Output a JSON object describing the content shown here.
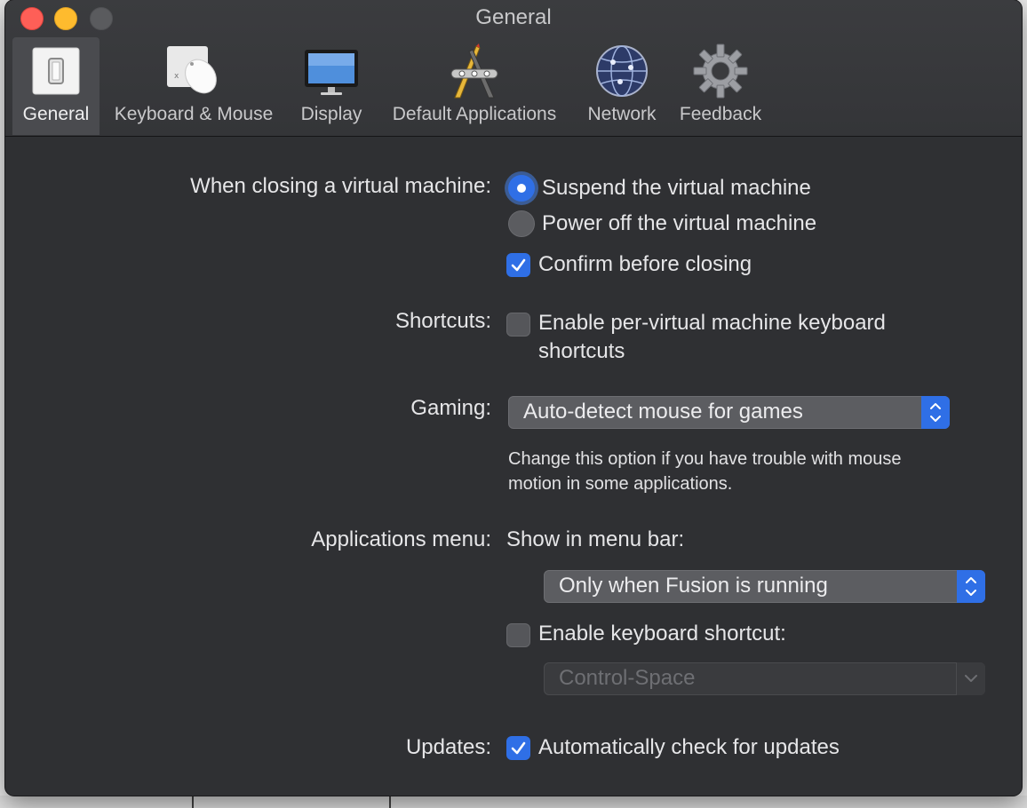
{
  "window": {
    "title": "General"
  },
  "toolbar": {
    "items": [
      {
        "label": "General",
        "icon": "switch-icon"
      },
      {
        "label": "Keyboard & Mouse",
        "icon": "mouse-icon"
      },
      {
        "label": "Display",
        "icon": "monitor-icon"
      },
      {
        "label": "Default Applications",
        "icon": "tools-icon"
      },
      {
        "label": "Network",
        "icon": "globe-icon"
      },
      {
        "label": "Feedback",
        "icon": "gear-icon"
      }
    ],
    "selected": "General"
  },
  "closing": {
    "label": "When closing a virtual machine:",
    "option_suspend": "Suspend the virtual machine",
    "option_poweroff": "Power off the virtual machine",
    "selected": "Suspend the virtual machine",
    "confirm_label": "Confirm before closing",
    "confirm_checked": true
  },
  "shortcuts": {
    "label": "Shortcuts:",
    "checkbox_line1": "Enable per-virtual machine keyboard",
    "checkbox_line2": "shortcuts",
    "checked": false
  },
  "gaming": {
    "label": "Gaming:",
    "value": "Auto-detect mouse for games",
    "hint_line1": "Change this option if you have trouble with mouse",
    "hint_line2": "motion in some applications."
  },
  "apps_menu": {
    "label": "Applications menu:",
    "sublabel": "Show in menu bar:",
    "value": "Only when Fusion is running",
    "shortcut_label": "Enable keyboard shortcut:",
    "shortcut_checked": false,
    "shortcut_value": "Control-Space",
    "shortcut_enabled": false
  },
  "updates": {
    "label": "Updates:",
    "checkbox_label": "Automatically check for updates",
    "checked": true
  },
  "colors": {
    "accent": "#2f6fe6",
    "window_bg": "#2f3033",
    "close": "#fe5f57",
    "minimize": "#febb2e"
  }
}
